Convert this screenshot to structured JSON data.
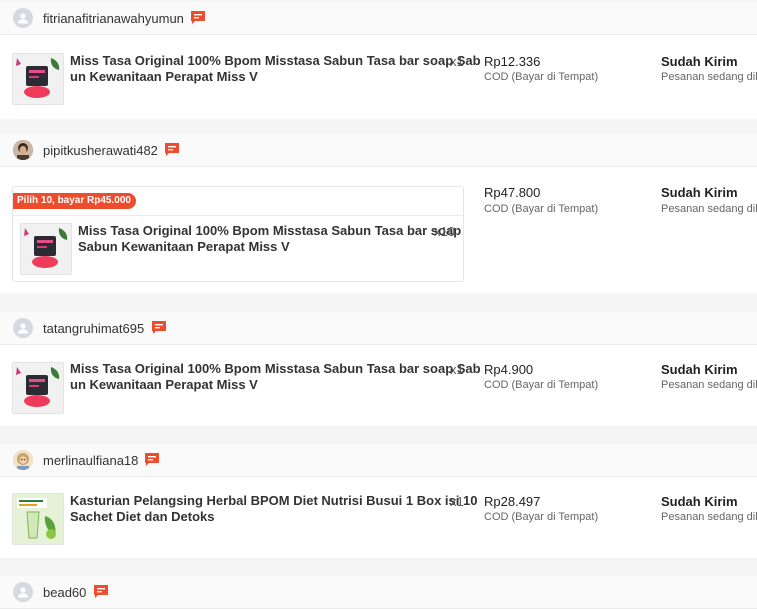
{
  "colors": {
    "accent": "#ee4d2d",
    "header_bg": "#fafafa",
    "page_bg": "#f5f5f5"
  },
  "orders": [
    {
      "username": "fitrianafitrianawahyumun",
      "avatar": "default-avatar-icon",
      "product_name_line1": "Miss Tasa Original 100% Bpom Misstasa Sabun Tasa bar soap Sab",
      "product_name_line2": "un Kewanitaan Perapat Miss V",
      "quantity": "x1",
      "price": "Rp12.336",
      "payment_method": "COD (Bayar di Tempat)",
      "status": "Sudah Kirim",
      "status_detail": "Pesanan sedang dikirim"
    },
    {
      "username": "pipitkusherawati482",
      "avatar": "photo-avatar",
      "bundle_label": "Pilih 10, bayar Rp45.000",
      "product_name_line1": "Miss Tasa Original 100% Bpom Misstasa Sabun Tasa bar soap",
      "product_name_line2": "Sabun Kewanitaan Perapat Miss V",
      "quantity": "x10",
      "price": "Rp47.800",
      "payment_method": "COD (Bayar di Tempat)",
      "status": "Sudah Kirim",
      "status_detail": "Pesanan sedang dikirim"
    },
    {
      "username": "tatangruhimat695",
      "avatar": "default-avatar-icon",
      "product_name_line1": "Miss Tasa Original 100% Bpom Misstasa Sabun Tasa bar soap Sab",
      "product_name_line2": "un Kewanitaan Perapat Miss V",
      "quantity": "x1",
      "price": "Rp4.900",
      "payment_method": "COD (Bayar di Tempat)",
      "status": "Sudah Kirim",
      "status_detail": "Pesanan sedang dikirim"
    },
    {
      "username": "merlinaulfiana18",
      "avatar": "photo-avatar",
      "product_name_line1": "Kasturian Pelangsing Herbal BPOM Diet Nutrisi Busui 1 Box isi 10",
      "product_name_line2": "Sachet Diet dan Detoks",
      "quantity": "x1",
      "price": "Rp28.497",
      "payment_method": "COD (Bayar di Tempat)",
      "status": "Sudah Kirim",
      "status_detail": "Pesanan sedang dikirim"
    },
    {
      "username": "bead60",
      "avatar": "default-avatar-icon"
    }
  ]
}
